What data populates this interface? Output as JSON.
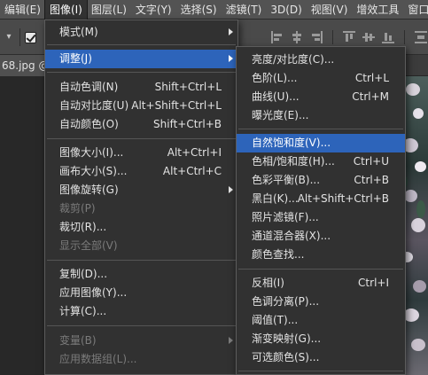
{
  "menubar": {
    "items": [
      {
        "label": "编辑(E)"
      },
      {
        "label": "图像(I)"
      },
      {
        "label": "图层(L)"
      },
      {
        "label": "文字(Y)"
      },
      {
        "label": "选择(S)"
      },
      {
        "label": "滤镜(T)"
      },
      {
        "label": "3D(D)"
      },
      {
        "label": "视图(V)"
      },
      {
        "label": "增效工具"
      },
      {
        "label": "窗口(W"
      }
    ]
  },
  "doc_tab": {
    "label": "68.jpg @"
  },
  "image_menu": {
    "items": [
      {
        "label": "模式(M)",
        "shortcut": ""
      },
      {
        "label": "调整(J)",
        "shortcut": ""
      },
      {
        "label": "自动色调(N)",
        "shortcut": "Shift+Ctrl+L"
      },
      {
        "label": "自动对比度(U)",
        "shortcut": "Alt+Shift+Ctrl+L"
      },
      {
        "label": "自动颜色(O)",
        "shortcut": "Shift+Ctrl+B"
      },
      {
        "label": "图像大小(I)...",
        "shortcut": "Alt+Ctrl+I"
      },
      {
        "label": "画布大小(S)...",
        "shortcut": "Alt+Ctrl+C"
      },
      {
        "label": "图像旋转(G)",
        "shortcut": ""
      },
      {
        "label": "裁剪(P)",
        "shortcut": ""
      },
      {
        "label": "裁切(R)...",
        "shortcut": ""
      },
      {
        "label": "显示全部(V)",
        "shortcut": ""
      },
      {
        "label": "复制(D)...",
        "shortcut": ""
      },
      {
        "label": "应用图像(Y)...",
        "shortcut": ""
      },
      {
        "label": "计算(C)...",
        "shortcut": ""
      },
      {
        "label": "变量(B)",
        "shortcut": ""
      },
      {
        "label": "应用数据组(L)...",
        "shortcut": ""
      }
    ]
  },
  "adjust_menu": {
    "items": [
      {
        "label": "亮度/对比度(C)...",
        "shortcut": ""
      },
      {
        "label": "色阶(L)...",
        "shortcut": "Ctrl+L"
      },
      {
        "label": "曲线(U)...",
        "shortcut": "Ctrl+M"
      },
      {
        "label": "曝光度(E)...",
        "shortcut": ""
      },
      {
        "label": "自然饱和度(V)...",
        "shortcut": ""
      },
      {
        "label": "色相/饱和度(H)...",
        "shortcut": "Ctrl+U"
      },
      {
        "label": "色彩平衡(B)...",
        "shortcut": "Ctrl+B"
      },
      {
        "label": "黑白(K)...",
        "shortcut": "Alt+Shift+Ctrl+B"
      },
      {
        "label": "照片滤镜(F)...",
        "shortcut": ""
      },
      {
        "label": "通道混合器(X)...",
        "shortcut": ""
      },
      {
        "label": "颜色查找...",
        "shortcut": ""
      },
      {
        "label": "反相(I)",
        "shortcut": "Ctrl+I"
      },
      {
        "label": "色调分离(P)...",
        "shortcut": ""
      },
      {
        "label": "阈值(T)...",
        "shortcut": ""
      },
      {
        "label": "渐变映射(G)...",
        "shortcut": ""
      },
      {
        "label": "可选颜色(S)...",
        "shortcut": ""
      }
    ]
  },
  "colors": {
    "highlight": "#2d64ba",
    "menu_bg": "#313131",
    "menubar_bg": "#535353",
    "disabled_text": "#7b7b7b"
  }
}
